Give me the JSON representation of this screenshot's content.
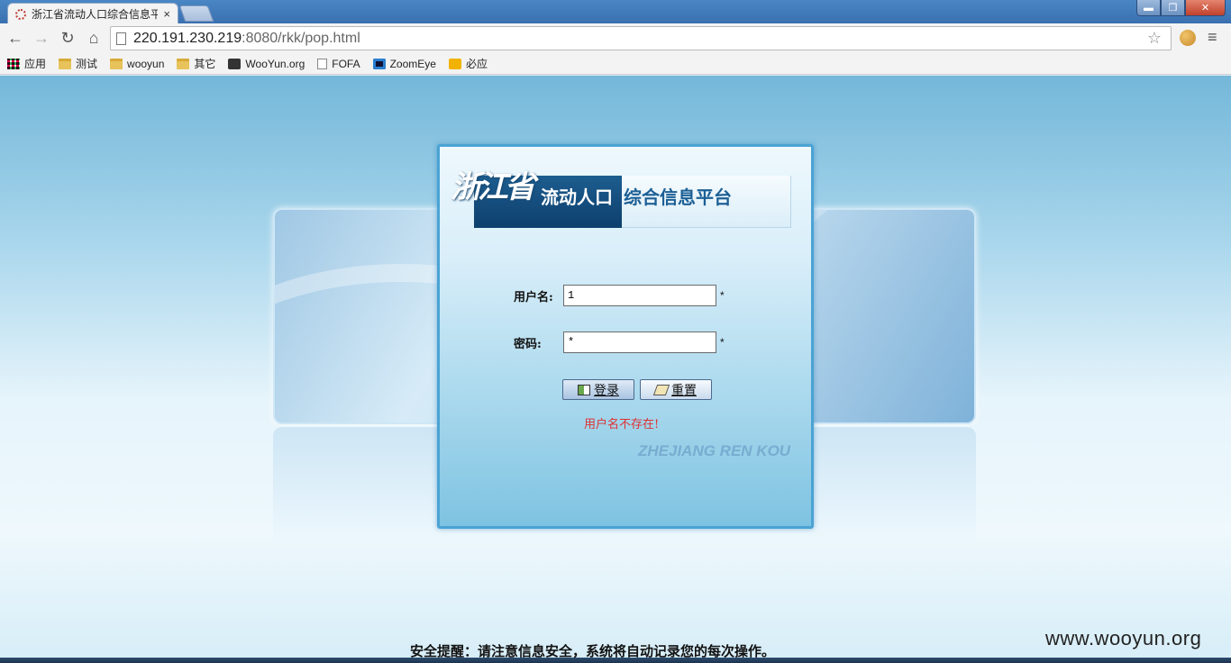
{
  "browser": {
    "tab_title": "浙江省流动人口综合信息平",
    "tab_close": "×",
    "url_host": "220.191.230.219",
    "url_rest": ":8080/rkk/pop.html",
    "window_controls": {
      "minimize": "▬",
      "maximize": "❐",
      "close": "✕"
    },
    "nav": {
      "back": "←",
      "forward": "→",
      "reload": "↻",
      "home": "⌂"
    },
    "star": "☆",
    "menu": "≡"
  },
  "bookmarks": [
    {
      "label": "应用",
      "icon": "apps-icon"
    },
    {
      "label": "测试",
      "icon": "folder-icon"
    },
    {
      "label": "wooyun",
      "icon": "folder-icon"
    },
    {
      "label": "其它",
      "icon": "folder-icon"
    },
    {
      "label": "WooYun.org",
      "icon": "wooyun-icon"
    },
    {
      "label": "FOFA",
      "icon": "page-icon"
    },
    {
      "label": "ZoomEye",
      "icon": "zoomeye-icon"
    },
    {
      "label": "必应",
      "icon": "bing-icon"
    }
  ],
  "logo": {
    "calligraphy": "浙江省",
    "dark_text": "流动人口",
    "light_text": "综合信息平台"
  },
  "login": {
    "username_label": "用户名:",
    "username_value": "1",
    "password_label": "密码:",
    "password_value": "*",
    "required_mark": "*",
    "login_button": "登录",
    "reset_button": "重置",
    "error": "用户名不存在!",
    "pinyin": "ZHEJIANG REN KOU"
  },
  "footer": {
    "notice": "安全提醒：请注意信息安全，系统将自动记录您的每次操作。",
    "watermark": "www.wooyun.org"
  },
  "colors": {
    "panel_border": "#4aa3d4",
    "logo_dark": "#0d3f6d",
    "logo_text": "#1c5f95",
    "error": "#e03030"
  }
}
